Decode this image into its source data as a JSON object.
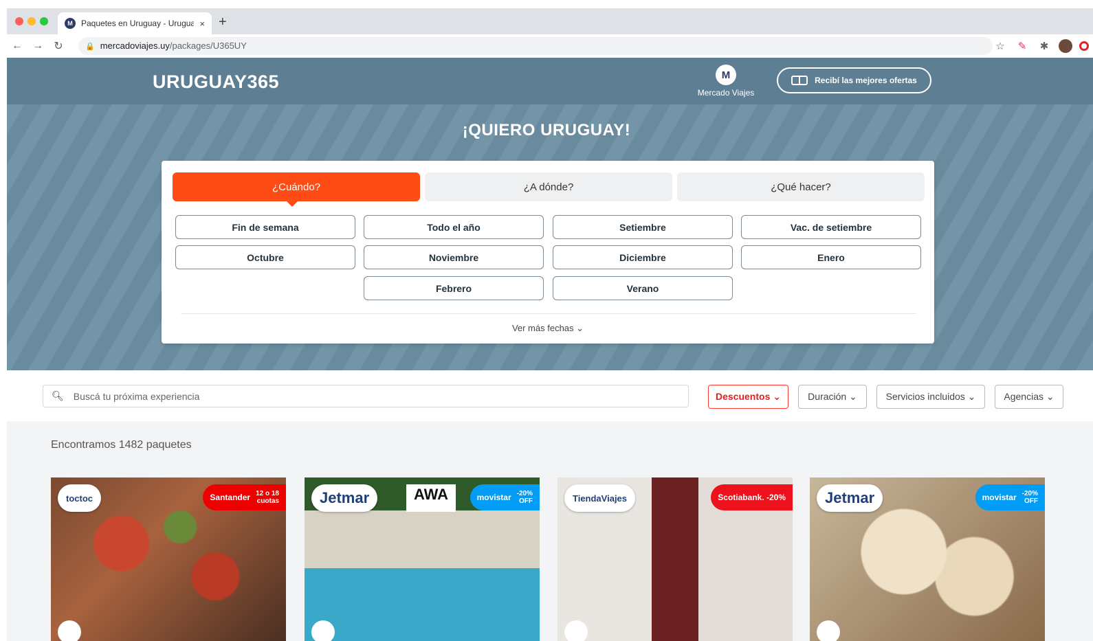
{
  "browser": {
    "tab_title": "Paquetes en Uruguay - Uruguay",
    "tab_close": "×",
    "new_tab": "+",
    "url_host": "mercadoviajes.uy",
    "url_path": "/packages/U365UY",
    "back": "←",
    "forward": "→",
    "reload": "↻",
    "star": "☆",
    "puzzle": "✱"
  },
  "header": {
    "logo": "URUGUAY365",
    "brand_initial": "M",
    "brand_label": "Mercado Viajes",
    "offers_label": "Recibí las mejores ofertas"
  },
  "hero": {
    "title": "¡QUIERO URUGUAY!",
    "tabs": [
      "¿Cuándo?",
      "¿A dónde?",
      "¿Qué hacer?"
    ],
    "chips": [
      "Fin de semana",
      "Todo el año",
      "Setiembre",
      "Vac. de setiembre",
      "Octubre",
      "Noviembre",
      "Diciembre",
      "Enero",
      "Febrero",
      "Verano"
    ],
    "more_dates": "Ver más fechas ⌄"
  },
  "filters": {
    "search_placeholder": "Buscá tu próxima experiencia",
    "buttons": [
      "Descuentos ⌄",
      "Duración ⌄",
      "Servicios incluidos ⌄",
      "Agencias ⌄"
    ]
  },
  "results": {
    "count_text": "Encontramos 1482 paquetes"
  },
  "cards": [
    {
      "agency": "toctoc",
      "badge": "Santander",
      "badge_sub": "12 o 18\ncuotas"
    },
    {
      "agency": "Jetmar",
      "logo2": "AWA",
      "badge": "movistar",
      "badge_sub": "-20%\nOFF"
    },
    {
      "agency": "TiendaViajes",
      "badge": "Scotiabank. -20%"
    },
    {
      "agency": "Jetmar",
      "badge": "movistar",
      "badge_sub": "-20%\nOFF"
    }
  ],
  "colors": {
    "header": "#5e7f93",
    "accent_orange": "#ff4c15",
    "discount_red": "#e0201b"
  }
}
